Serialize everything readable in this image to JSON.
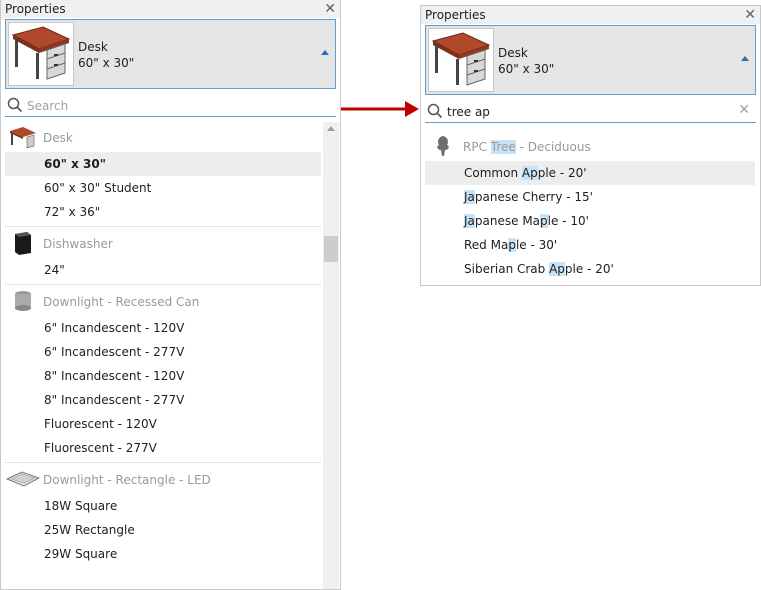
{
  "left": {
    "title": "Properties",
    "type_selector": {
      "name": "Desk",
      "size": "60\" x 30\""
    },
    "search_placeholder": "Search",
    "groups": [
      {
        "label": "Desk",
        "items": [
          "60\" x 30\"",
          "60\" x 30\" Student",
          "72\" x 36\""
        ]
      },
      {
        "label": "Dishwasher",
        "items": [
          "24\""
        ]
      },
      {
        "label": "Downlight - Recessed Can",
        "items": [
          "6\" Incandescent - 120V",
          "6\" Incandescent - 277V",
          "8\" Incandescent - 120V",
          "8\" Incandescent - 277V",
          "Fluorescent - 120V",
          "Fluorescent - 277V"
        ]
      },
      {
        "label": "Downlight - Rectangle - LED",
        "items": [
          "18W Square",
          "25W Rectangle",
          "29W Square"
        ]
      }
    ]
  },
  "right": {
    "title": "Properties",
    "type_selector": {
      "name": "Desk",
      "size": "60\" x 30\""
    },
    "search_value": "tree ap",
    "group": {
      "p1": "RPC ",
      "hl": "Tree",
      "p2": " - Deciduous"
    },
    "items": [
      {
        "a": "Common ",
        "b": "Ap",
        "c": "ple - 20'"
      },
      {
        "a": "",
        "b": "Ja",
        "c": "panese Cherry - 15'"
      },
      {
        "a": "",
        "b": "Ja",
        "c": "panese Ma"
      },
      {
        "a": "Red Ma",
        "b": "p",
        "c": "le - 30'"
      },
      {
        "a": "Siberian Crab ",
        "b": "Ap",
        "c": "ple - 20'"
      }
    ],
    "item3_rest": {
      "b2": "p",
      "c2": "le - 10'"
    }
  },
  "colors": {
    "accent": "#5c9fd6",
    "highlight": "#c7e3f7",
    "arrow": "#c00000",
    "desk_top": "#b0482a"
  },
  "icons": {
    "close": "close-icon",
    "search": "search-icon",
    "dropdown": "dropdown-arrow-icon"
  }
}
